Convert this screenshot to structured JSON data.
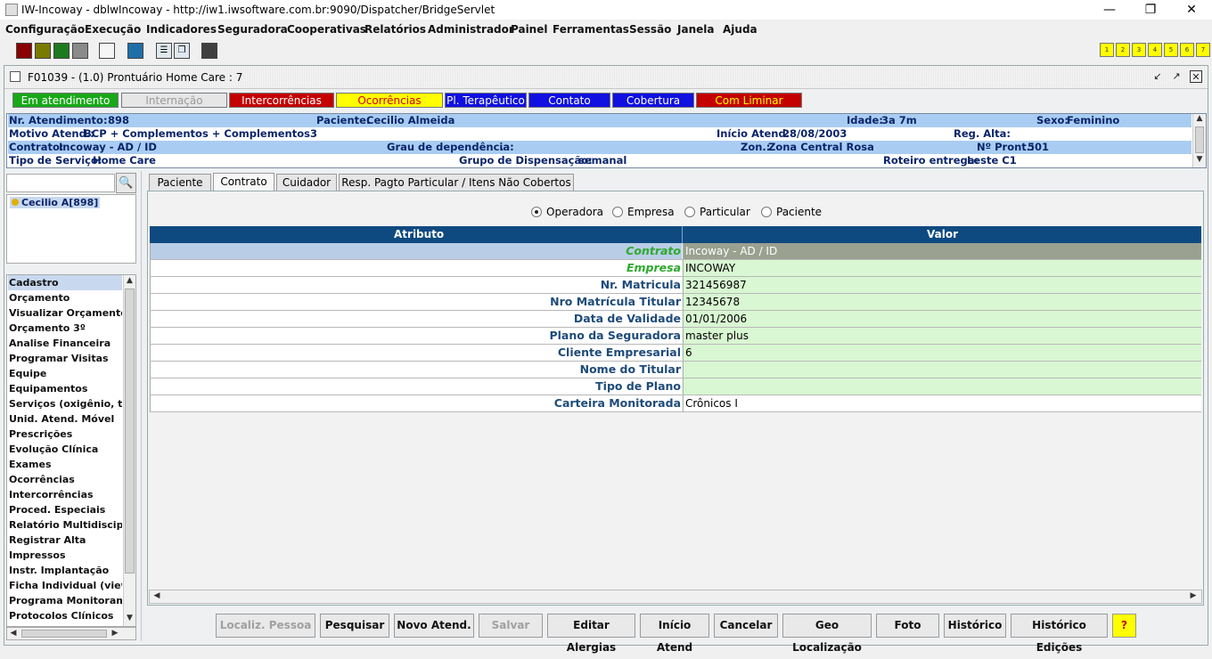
{
  "window": {
    "title": "IW-Incoway - dblwIncoway - http://iw1.iwsoftware.com.br:9090/Dispatcher/BridgeServlet"
  },
  "menu": [
    "Configuração",
    "Execução",
    "Indicadores",
    "Seguradora",
    "Cooperativas",
    "Relatórios",
    "Administrador",
    "Painel",
    "Ferramentas",
    "Sessão",
    "Janela",
    "Ajuda"
  ],
  "toolbar": {
    "swatches": [
      "#8b0000",
      "#7a7a00",
      "#1e7a1e",
      "#8a8a8a",
      "#f5f5f5",
      "#1e6fa8",
      "#404040"
    ],
    "numbered": [
      "1",
      "2",
      "3",
      "4",
      "5",
      "6",
      "7"
    ]
  },
  "frame": {
    "title": "F01039 - (1.0) Prontuário Home Care : 7"
  },
  "status_buttons": [
    {
      "label": "Em atendimento",
      "bg": "#18a818",
      "fg": "#ffffff"
    },
    {
      "label": "Internação",
      "bg": "#e6e6e6",
      "fg": "#9a9a9a"
    },
    {
      "label": "Intercorrências",
      "bg": "#c40000",
      "fg": "#ffffff"
    },
    {
      "label": "Ocorrências",
      "bg": "#ffff00",
      "fg": "#d00000"
    },
    {
      "label": "Pl. Terapêutico",
      "bg": "#1010e0",
      "fg": "#ffffff"
    },
    {
      "label": "Contato",
      "bg": "#1010e0",
      "fg": "#ffffff"
    },
    {
      "label": "Cobertura",
      "bg": "#1010e0",
      "fg": "#ffffff"
    },
    {
      "label": "Com Liminar",
      "bg": "#c40000",
      "fg": "#ffff00"
    }
  ],
  "info": {
    "nr_atendimento_label": "Nr. Atendimento:",
    "nr_atendimento": "898",
    "paciente_label": "Paciente:",
    "paciente": "Cecilio Almeida",
    "idade_label": "Idade:",
    "idade": "3a 7m",
    "sexo_label": "Sexo:",
    "sexo": "Feminino",
    "motivo_label": "Motivo Atend.:",
    "motivo": "BCP + Complementos + Complementos3",
    "inicio_label": "Início Atend:",
    "inicio": "28/08/2003",
    "reg_alta_label": "Reg. Alta:",
    "contrato_label": "Contrato:",
    "contrato": "Incoway - AD / ID",
    "grau_label": "Grau de dependência:",
    "grau": ".",
    "zon_label": "Zon.:",
    "zon": "Zona Central Rosa",
    "pront_label": "Nº Pront.:",
    "pront": "501",
    "tipo_label": "Tipo de Serviço:",
    "tipo": "Home Care",
    "grupo_label": "Grupo de Dispensação:",
    "grupo": "semanal",
    "roteiro_label": "Roteiro entrega:",
    "roteiro": "Leste C1"
  },
  "patient_list": [
    "Cecilio A[898]"
  ],
  "nav": [
    "Cadastro",
    "Orçamento",
    "Visualizar Orçamento",
    "Orçamento 3º",
    "Analise Financeira",
    "Programar Visitas",
    "Equipe",
    "Equipamentos",
    "Serviços (oxigênio, taxa",
    "Unid. Atend. Móvel",
    "Prescrições",
    "Evolução Clínica",
    "Exames",
    "Ocorrências",
    "Intercorrências",
    "Proced. Especiais",
    "Relatório Multidisciplina",
    "Registrar Alta",
    "Impressos",
    "Instr. Implantação",
    "Ficha Individual (viewer",
    "Programa Monitoramen",
    "Protocolos Clínicos"
  ],
  "tabs": [
    "Paciente",
    "Contrato",
    "Cuidador",
    "Resp. Pagto Particular / Itens Não Cobertos"
  ],
  "active_tab": "Contrato",
  "radios": [
    {
      "label": "Operadora",
      "checked": true
    },
    {
      "label": "Empresa",
      "checked": false
    },
    {
      "label": "Particular",
      "checked": false
    },
    {
      "label": "Paciente",
      "checked": false
    }
  ],
  "table": {
    "headers": [
      "Atributo",
      "Valor"
    ],
    "rows": [
      {
        "attr": "Contrato",
        "value": "Incoway - AD / ID"
      },
      {
        "attr": "Empresa",
        "value": "INCOWAY"
      },
      {
        "attr": "Nr. Matricula",
        "value": "321456987"
      },
      {
        "attr": "Nro Matrícula Titular",
        "value": "12345678"
      },
      {
        "attr": "Data de Validade",
        "value": "01/01/2006"
      },
      {
        "attr": "Plano da Seguradora",
        "value": "master plus"
      },
      {
        "attr": "Cliente Empresarial",
        "value": "6"
      },
      {
        "attr": "Nome do Titular",
        "value": ""
      },
      {
        "attr": "Tipo de Plano",
        "value": ""
      },
      {
        "attr": "Carteira Monitorada",
        "value": "Crônicos I"
      }
    ]
  },
  "buttons": [
    {
      "label": "Localiz. Pessoa",
      "enabled": false
    },
    {
      "label": "Pesquisar",
      "enabled": true
    },
    {
      "label": "Novo Atend.",
      "enabled": true
    },
    {
      "label": "Salvar",
      "enabled": false
    },
    {
      "label": "Editar Alergias",
      "enabled": true
    },
    {
      "label": "Início Atend",
      "enabled": true
    },
    {
      "label": "Cancelar",
      "enabled": true
    },
    {
      "label": "Geo Localização",
      "enabled": true
    },
    {
      "label": "Foto",
      "enabled": true
    },
    {
      "label": "Histórico",
      "enabled": true
    },
    {
      "label": "Histórico Edições",
      "enabled": true
    },
    {
      "label": "?",
      "enabled": true
    }
  ]
}
